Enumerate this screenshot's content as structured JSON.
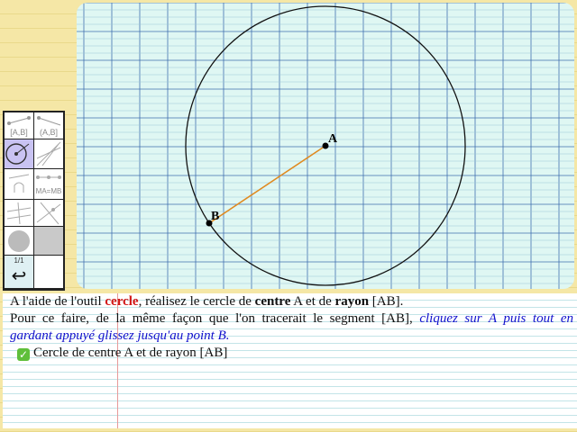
{
  "canvas": {
    "point_a_label": "A",
    "point_b_label": "B",
    "grid_color": "#3f6fae",
    "grid_bg": "#dff7f3",
    "segment_color": "#e08a20",
    "circle_color": "#111111"
  },
  "toolbar": {
    "tools": [
      {
        "name": "segment-tool",
        "label": "[A,B]"
      },
      {
        "name": "ray-tool",
        "label": "(A,B]"
      },
      {
        "name": "circle-tool",
        "label": ""
      },
      {
        "name": "lines-tool",
        "label": ""
      },
      {
        "name": "arc-tool",
        "label": ""
      },
      {
        "name": "midpoint-tool",
        "label": "MA=MB"
      },
      {
        "name": "perpendicular-tool",
        "label": ""
      },
      {
        "name": "parallel-tool",
        "label": ""
      },
      {
        "name": "fill-circle-tool",
        "label": ""
      },
      {
        "name": "fill-gray-tool",
        "label": ""
      },
      {
        "name": "undo-tool",
        "label": "1/1"
      },
      {
        "name": "blank-tool",
        "label": ""
      }
    ],
    "undo_symbol": "↩"
  },
  "instructions": {
    "l1_a": "A l'aide de l'outil ",
    "l1_tool": "cercle",
    "l1_b": ", réalisez le cercle de ",
    "l1_centre": "centre",
    "l1_c": " A et de ",
    "l1_rayon": "rayon",
    "l1_d": " [AB].",
    "l2_a": "Pour ce faire, de la même façon que l'on tracerait le segment [AB], ",
    "l2_blue": "cliquez sur A puis tout en",
    "l3_blue": "gardant appuyé glissez jusqu'au point B.",
    "task_label": "Cercle de centre A et de rayon [AB]",
    "task_status": "done"
  }
}
